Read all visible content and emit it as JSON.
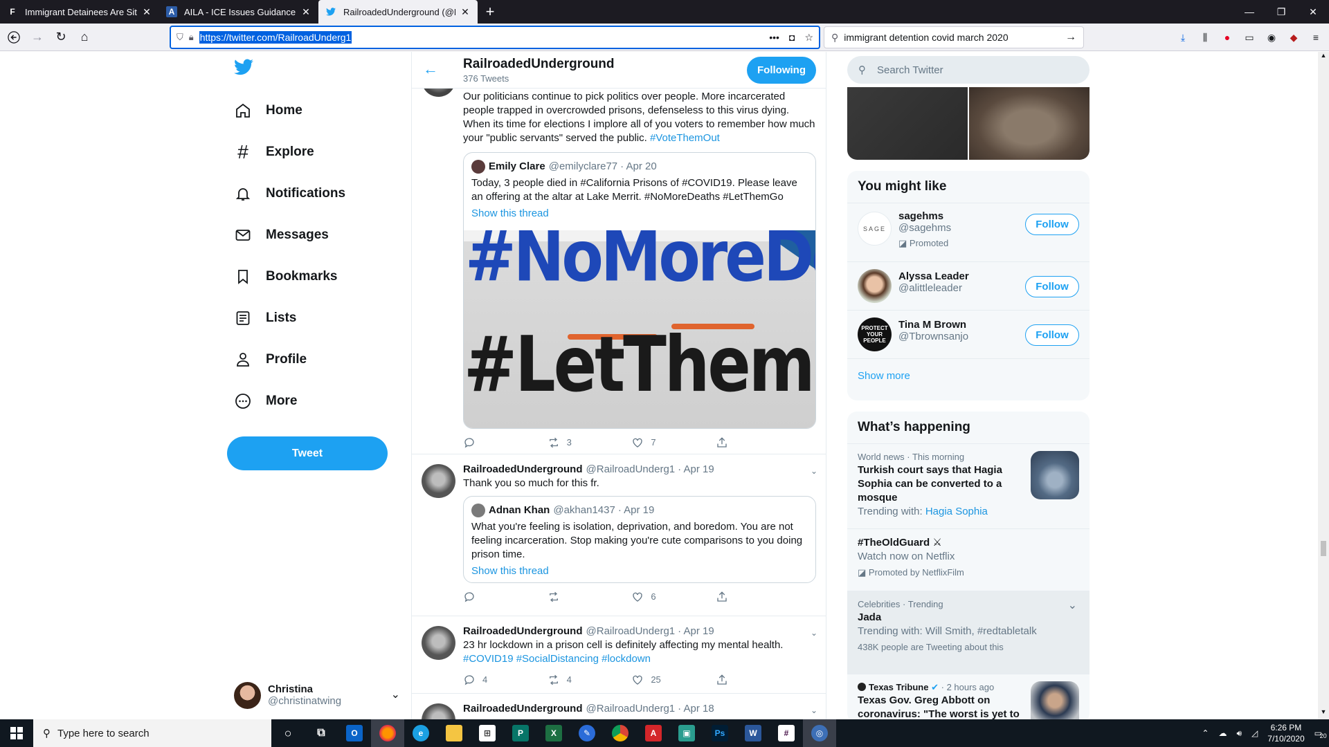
{
  "browser": {
    "tabs": [
      {
        "title": "Immigrant Detainees Are Sitting",
        "favicon": "F",
        "active": false
      },
      {
        "title": "AILA - ICE Issues Guidance on (",
        "favicon": "A",
        "active": false
      },
      {
        "title": "RailroadedUnderground (@Rai",
        "favicon": "twitter-bird",
        "active": true
      }
    ],
    "new_tab": "+",
    "url": "https://twitter.com/RailroadUnderg1",
    "search_query": "immigrant detention covid march 2020"
  },
  "twitter": {
    "nav": [
      {
        "label": "Home",
        "icon": "home-icon"
      },
      {
        "label": "Explore",
        "icon": "hashtag-icon"
      },
      {
        "label": "Notifications",
        "icon": "bell-icon"
      },
      {
        "label": "Messages",
        "icon": "envelope-icon"
      },
      {
        "label": "Bookmarks",
        "icon": "bookmark-icon"
      },
      {
        "label": "Lists",
        "icon": "list-icon"
      },
      {
        "label": "Profile",
        "icon": "person-icon"
      },
      {
        "label": "More",
        "icon": "more-icon"
      }
    ],
    "tweet_button": "Tweet",
    "account": {
      "name": "Christina",
      "handle": "@christinatwing"
    },
    "header": {
      "title": "RailroadedUnderground",
      "subtitle": "376 Tweets",
      "follow_state": "Following"
    },
    "tweets": [
      {
        "text_parts": [
          "Our politicians continue to pick politics over people. More incarcerated people trapped in overcrowded prisons, defenseless to this virus dying. When its time for elections I implore all of you voters to remember how much your \"public servants\" served the public. "
        ],
        "hashtags": "#VoteThemOut",
        "quote": {
          "name": "Emily Clare",
          "handle": "@emilyclare77",
          "date": "· Apr 20",
          "text": "Today, 3 people died in #California Prisons of #COVID19. Please leave an offering at the altar at Lake Merrit.  #NoMoreDeaths #LetThemGo",
          "show_thread": "Show this thread",
          "image_text_1": "#NoMoreDeath",
          "image_text_2": "#LetThemGo"
        },
        "reply_count": "",
        "retweet_count": "3",
        "like_count": "7"
      },
      {
        "name": "RailroadedUnderground",
        "handle": "@RailroadUnderg1",
        "date": "· Apr 19",
        "text": "Thank you so much for this fr.",
        "quote": {
          "name": "Adnan Khan",
          "handle": "@akhan1437",
          "date": "· Apr 19",
          "text": "What you're feeling is isolation, deprivation, and boredom. You are not feeling incarceration. Stop making you're cute comparisons to you doing prison time.",
          "show_thread": "Show this thread"
        },
        "reply_count": "",
        "retweet_count": "",
        "like_count": "6"
      },
      {
        "name": "RailroadedUnderground",
        "handle": "@RailroadUnderg1",
        "date": "· Apr 19",
        "text": "23 hr lockdown in a prison cell is definitely affecting my mental health.",
        "hashtags": "#COVID19 #SocialDistancing #lockdown",
        "reply_count": "4",
        "retweet_count": "4",
        "like_count": "25"
      },
      {
        "name": "RailroadedUnderground",
        "handle": "@RailroadUnderg1",
        "date": "· Apr 18"
      }
    ],
    "search_placeholder": "Search Twitter",
    "you_might_like": {
      "title": "You might like",
      "accounts": [
        {
          "name": "sagehms",
          "handle": "@sagehms",
          "promoted": "Promoted",
          "button": "Follow",
          "avatar_text": "SAGE"
        },
        {
          "name": "Alyssa Leader",
          "handle": "@alittleleader",
          "button": "Follow"
        },
        {
          "name": "Tina M Brown",
          "handle": "@Tbrownsanjo",
          "button": "Follow",
          "avatar_text": "PROTECT YOUR PEOPLE"
        }
      ],
      "show_more": "Show more"
    },
    "whats_happening": {
      "title": "What’s happening",
      "trends": [
        {
          "meta": "World news · This morning",
          "title": "Turkish court says that Hagia Sophia can be converted to a mosque",
          "sub_prefix": "Trending with: ",
          "sub_link": "Hagia Sophia"
        },
        {
          "title": "#TheOldGuard",
          "sub": "Watch now on Netflix",
          "promoted": "Promoted by NetflixFilm"
        },
        {
          "meta": "Celebrities · Trending",
          "title": "Jada",
          "sub": "Trending with: Will Smith, #redtabletalk",
          "count": "438K people are Tweeting about this"
        },
        {
          "source": "Texas Tribune",
          "time": "· 2 hours ago",
          "title": "Texas Gov. Greg Abbott on coronavirus: \"The worst is yet to"
        }
      ]
    }
  },
  "taskbar": {
    "search_placeholder": "Type here to search",
    "time": "6:26 PM",
    "date": "7/10/2020",
    "notification_count": "20"
  },
  "colors": {
    "twitter_blue": "#1da1f2",
    "link_blue": "#1b95e0",
    "url_highlight": "#0061e0",
    "taskbar": "#101820"
  }
}
